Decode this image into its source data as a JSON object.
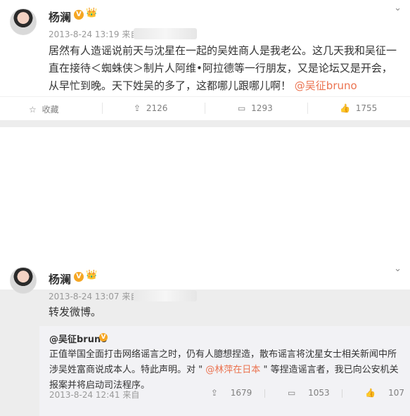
{
  "post1": {
    "author": "杨澜",
    "verify_badge": "V",
    "meta_time": "2013-8-24 13:19 来自",
    "content_main": "居然有人造谣说前天与沈星在一起的吴姓商人是我老公。这几天我和吴征一直在接待＜蜘蛛侠＞制片人阿维•阿拉德等一行朋友，又是论坛又是开会，从早忙到晚。天下姓吴的多了，这都哪儿跟哪儿啊！",
    "mention": "@吴征bruno",
    "actions": {
      "favorite_label": "收藏",
      "repost_count": "2126",
      "comment_count": "1293",
      "like_count": "1755"
    }
  },
  "post2": {
    "author": "杨澜",
    "verify_badge": "V",
    "meta_time": "2013-8-24 13:07 来自",
    "content": "转发微博。",
    "quoted": {
      "author": "@吴征bruno",
      "verify_badge": "V",
      "text_part1": "正值举国全面打击网络谣言之时，仍有人臆想捏造，散布谣言将沈星女士相关新闻中所涉吴姓富商说成本人。特此声明。对",
      "quote_open": "\"",
      "mention": "@林萍在日本",
      "quote_close": "\"",
      "text_part2": "等捏造谣言者，我已向公安机关报案并将启动司法程序。",
      "meta_time": "2013-8-24 12:41 来自",
      "repost_count": "1679",
      "comment_count": "1053",
      "like_count": "107"
    }
  },
  "icons": {
    "star": "☆",
    "repost": "⇪",
    "comment": "▭",
    "like": "👍",
    "chevron": "⌄",
    "crown": "👑"
  }
}
